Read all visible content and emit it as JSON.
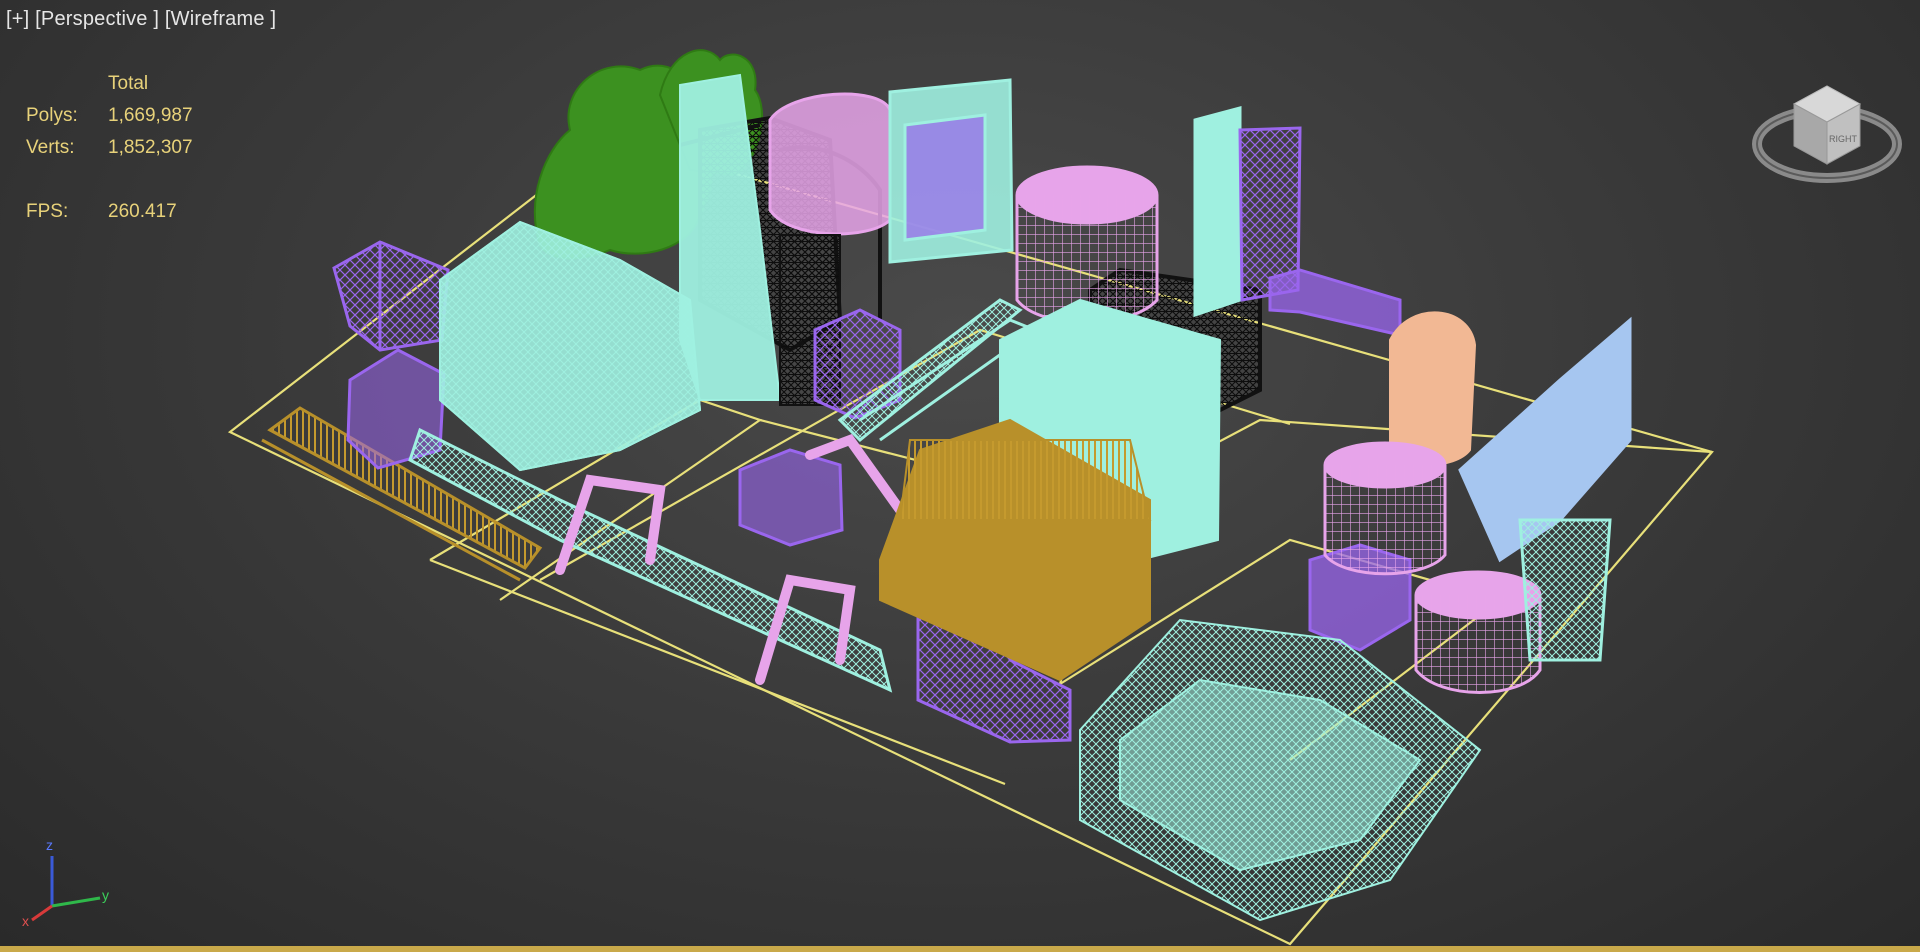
{
  "viewport": {
    "menu": {
      "plus": "[+]",
      "view": "[Perspective ]",
      "shading": "[Wireframe ]"
    },
    "stats": {
      "header": "Total",
      "polys_label": "Polys:",
      "polys_value": "1,669,987",
      "verts_label": "Verts:",
      "verts_value": "1,852,307",
      "fps_label": "FPS:",
      "fps_value": "260.417"
    },
    "axis_labels": {
      "x": "x",
      "y": "y",
      "z": "z"
    },
    "viewcube_face": "RIGHT"
  },
  "colors": {
    "grid_outline": "#e8e07a",
    "cyan": "#9ff0e0",
    "purple": "#9a66ee",
    "pink": "#e7a4ea",
    "green": "#3c9120",
    "black": "#111111",
    "gold": "#b8902a",
    "peach": "#f2b894",
    "blue": "#a6c6f0"
  }
}
